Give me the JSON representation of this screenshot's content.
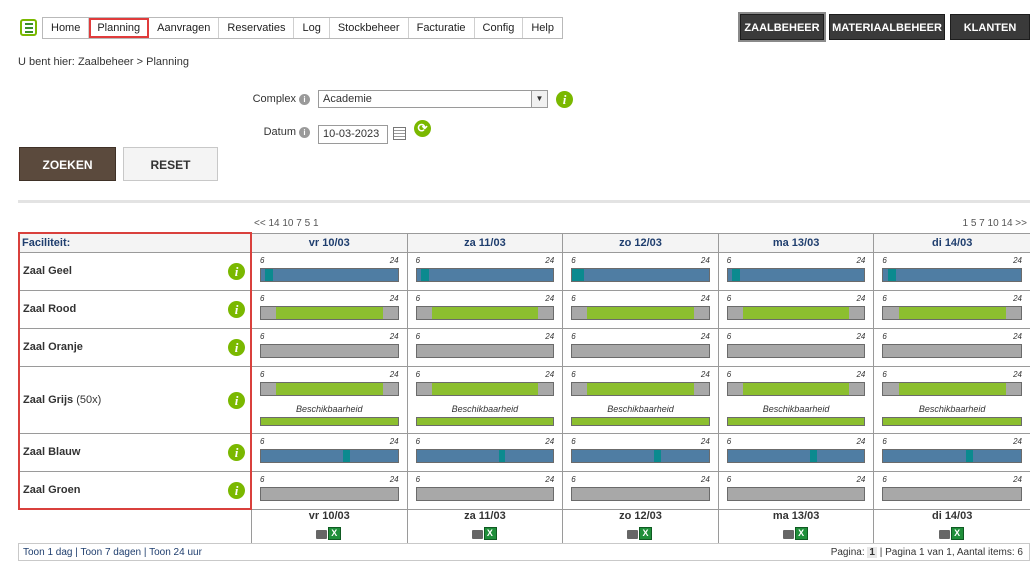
{
  "nav": {
    "items": [
      "Home",
      "Planning",
      "Aanvragen",
      "Reservaties",
      "Log",
      "Stockbeheer",
      "Facturatie",
      "Config",
      "Help"
    ],
    "active": "Planning"
  },
  "modules": [
    "ZAALBEHEER",
    "MATERIAALBEHEER",
    "KLANTEN"
  ],
  "breadcrumb": {
    "prefix": "U bent hier:",
    "parent": "Zaalbeheer",
    "separator": ">",
    "current": "Planning"
  },
  "form": {
    "complex_label": "Complex",
    "complex_value": "Academie",
    "datum_label": "Datum",
    "datum_value": "10-03-2023",
    "search_label": "ZOEKEN",
    "reset_label": "RESET"
  },
  "pager": {
    "left": "<< 14 10 7 5 1",
    "right": "1 5 7 10 14 >>"
  },
  "grid": {
    "facility_header": "Faciliteit:",
    "days": [
      "vr 10/03",
      "za 11/03",
      "zo 12/03",
      "ma 13/03",
      "di 14/03"
    ],
    "scale_start": "6",
    "scale_end": "24",
    "availability_label": "Beschikbaarheid",
    "facilities": [
      {
        "name": "Zaal Geel",
        "count": ""
      },
      {
        "name": "Zaal Rood",
        "count": ""
      },
      {
        "name": "Zaal Oranje",
        "count": ""
      },
      {
        "name": "Zaal Grijs",
        "count": "(50x)"
      },
      {
        "name": "Zaal Blauw",
        "count": ""
      },
      {
        "name": "Zaal Groen",
        "count": ""
      }
    ]
  },
  "footer": {
    "links": [
      "Toon 1 dag",
      "Toon 7 dagen",
      "Toon 24 uur"
    ],
    "page_label": "Pagina:",
    "page_current": "1",
    "page_summary": "| Pagina 1 van 1, Aantal items: 6"
  },
  "colors": {
    "blue_bar": "#4f7da3",
    "teal_marker": "#0b8a8f",
    "green_bar": "#8cbf2f",
    "grey_bar": "#a8a8a8",
    "accent_green": "#7ab800",
    "highlight_red": "#d9403c"
  }
}
